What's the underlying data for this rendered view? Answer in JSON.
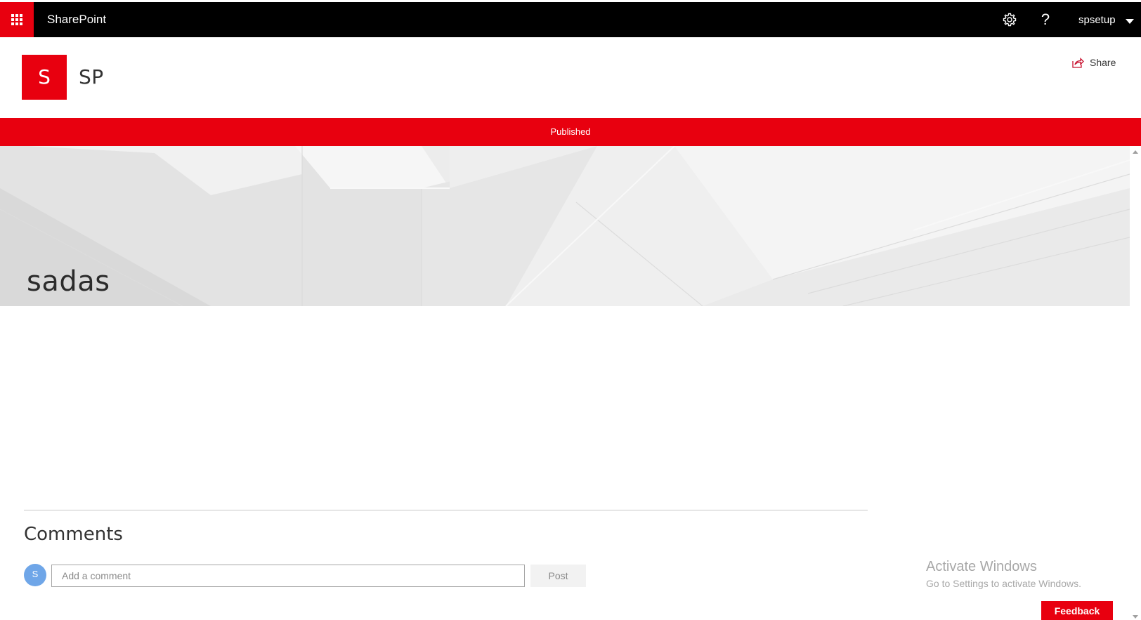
{
  "suite_bar": {
    "brand": "SharePoint",
    "waffle_icon": "app-launcher-icon",
    "settings_icon": "gear-icon",
    "help_label": "?",
    "user_name": "spsetup",
    "user_menu_icon": "chevron-down-icon"
  },
  "site": {
    "logo_letter": "S",
    "title": "SP",
    "share_label": "Share",
    "share_icon": "share-icon"
  },
  "status": {
    "published_label": "Published"
  },
  "page": {
    "title": "sadas"
  },
  "comments": {
    "heading": "Comments",
    "avatar_letter": "S",
    "input_placeholder": "Add a comment",
    "input_value": "",
    "post_label": "Post"
  },
  "watermark": {
    "title": "Activate Windows",
    "subtitle": "Go to Settings to activate Windows."
  },
  "feedback": {
    "label": "Feedback"
  },
  "colors": {
    "accent": "#e8000f",
    "suite_bar": "#000000",
    "avatar": "#6fa6e8"
  }
}
